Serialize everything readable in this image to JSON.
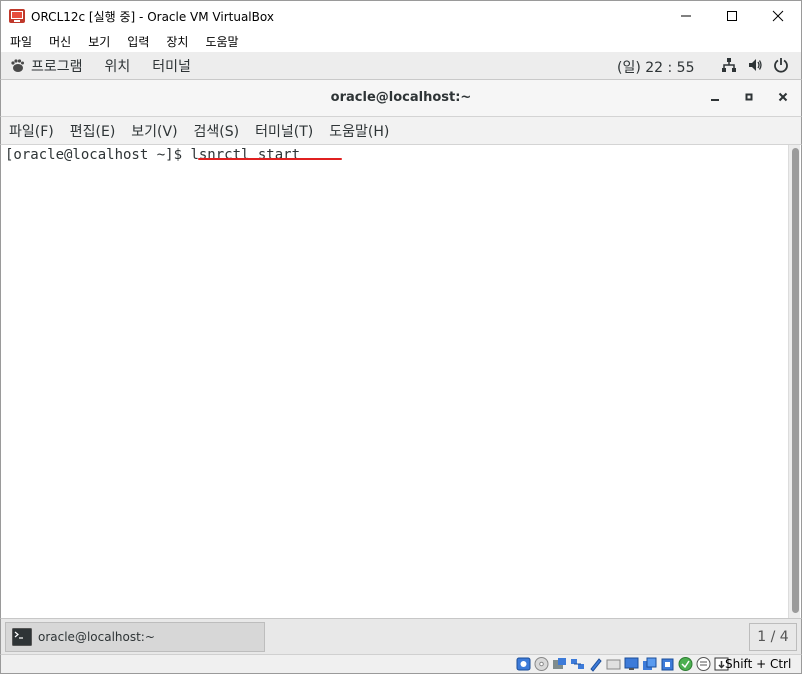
{
  "window": {
    "title": "ORCL12c [실행 중] - Oracle VM VirtualBox"
  },
  "vbox_menu": {
    "items": [
      "파일",
      "머신",
      "보기",
      "입력",
      "장치",
      "도움말"
    ]
  },
  "gnome_topbar": {
    "applications": "프로그램",
    "places": "위치",
    "app_menu": "터미널",
    "clock": "(일) 22 : 55"
  },
  "terminal": {
    "title": "oracle@localhost:~",
    "menu": [
      "파일(F)",
      "편집(E)",
      "보기(V)",
      "검색(S)",
      "터미널(T)",
      "도움말(H)"
    ],
    "prompt": "[oracle@localhost ~]$ ",
    "command": "lsnrctl start",
    "annotation_color": "#e02020"
  },
  "taskbar": {
    "window_item": "oracle@localhost:~",
    "workspace": "1 / 4"
  },
  "vbox_status": {
    "host_key": "Shift + Ctrl"
  },
  "icons": {
    "app": "virtualbox-icon",
    "network": "network-icon",
    "volume": "volume-icon",
    "power": "power-icon",
    "terminal": "terminal-icon"
  }
}
